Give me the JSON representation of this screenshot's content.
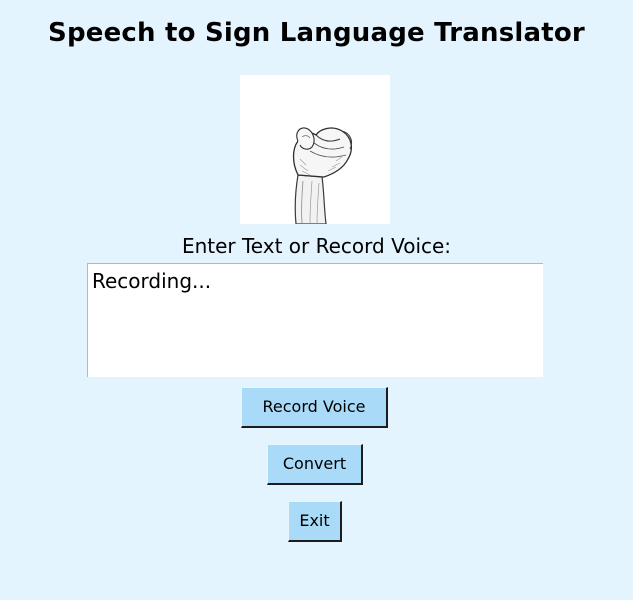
{
  "window": {
    "title": "Speech to Sign Language Translator"
  },
  "sign_image": {
    "icon": "hand-sign-icon"
  },
  "input": {
    "label": "Enter Text or Record Voice:",
    "value": "Recording..."
  },
  "buttons": {
    "record_label": "Record Voice",
    "convert_label": "Convert",
    "exit_label": "Exit"
  },
  "colors": {
    "background": "#e3f4fe",
    "button": "#a9daf7",
    "text_area": "#ffffff"
  }
}
